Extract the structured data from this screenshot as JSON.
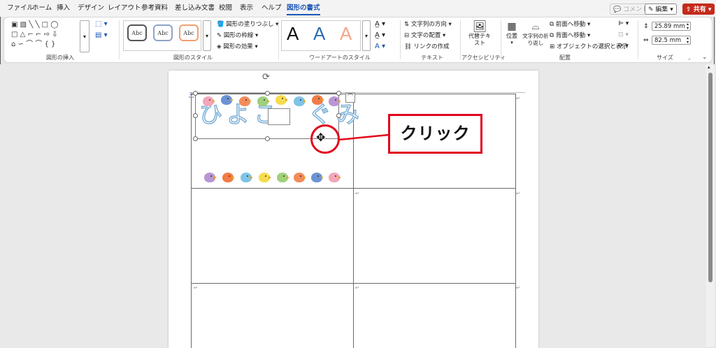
{
  "menu": {
    "items": [
      "ファイル",
      "ホーム",
      "挿入",
      "デザイン",
      "レイアウト",
      "参考資料",
      "差し込み文書",
      "校閲",
      "表示",
      "ヘルプ",
      "図形の書式"
    ],
    "active": "図形の書式",
    "comment": "コメント",
    "edit": "編集",
    "share": "共有"
  },
  "ribbon": {
    "groups": {
      "insert_shapes": "図形の挿入",
      "shape_styles": "図形のスタイル",
      "wordart_styles": "ワードアートのスタイル",
      "text": "テキスト",
      "accessibility": "アクセシビリティ",
      "arrange": "配置",
      "size": "サイズ"
    },
    "style_sample": "Abc",
    "fill": "図形の塗りつぶし",
    "outline": "図形の枠線",
    "effects": "図形の効果",
    "wordart_letter": "A",
    "text_direction": "文字列の方向",
    "text_align": "文字の配置",
    "create_link": "リンクの作成",
    "alt_text": "代替テキスト",
    "position": "位置",
    "wrap_text": "文字列の折り返し",
    "bring_forward": "前面へ移動",
    "send_backward": "背面へ移動",
    "selection_pane": "オブジェクトの選択と表示",
    "height": "25.89 mm",
    "width": "82.5 mm"
  },
  "document": {
    "title_text": "ひよこ　ぐみ",
    "paragraph_mark": "↵"
  },
  "callout": {
    "label": "クリック"
  },
  "colors": {
    "accent": "#1a56b8",
    "callout_red": "#e2061c",
    "share_red": "#c42b1c",
    "bird_colors": [
      "#f2a6b9",
      "#6b93d3",
      "#f28c5a",
      "#9fd07c",
      "#f6dd4e",
      "#7fc3e6",
      "#f07d46",
      "#b995d3"
    ]
  }
}
